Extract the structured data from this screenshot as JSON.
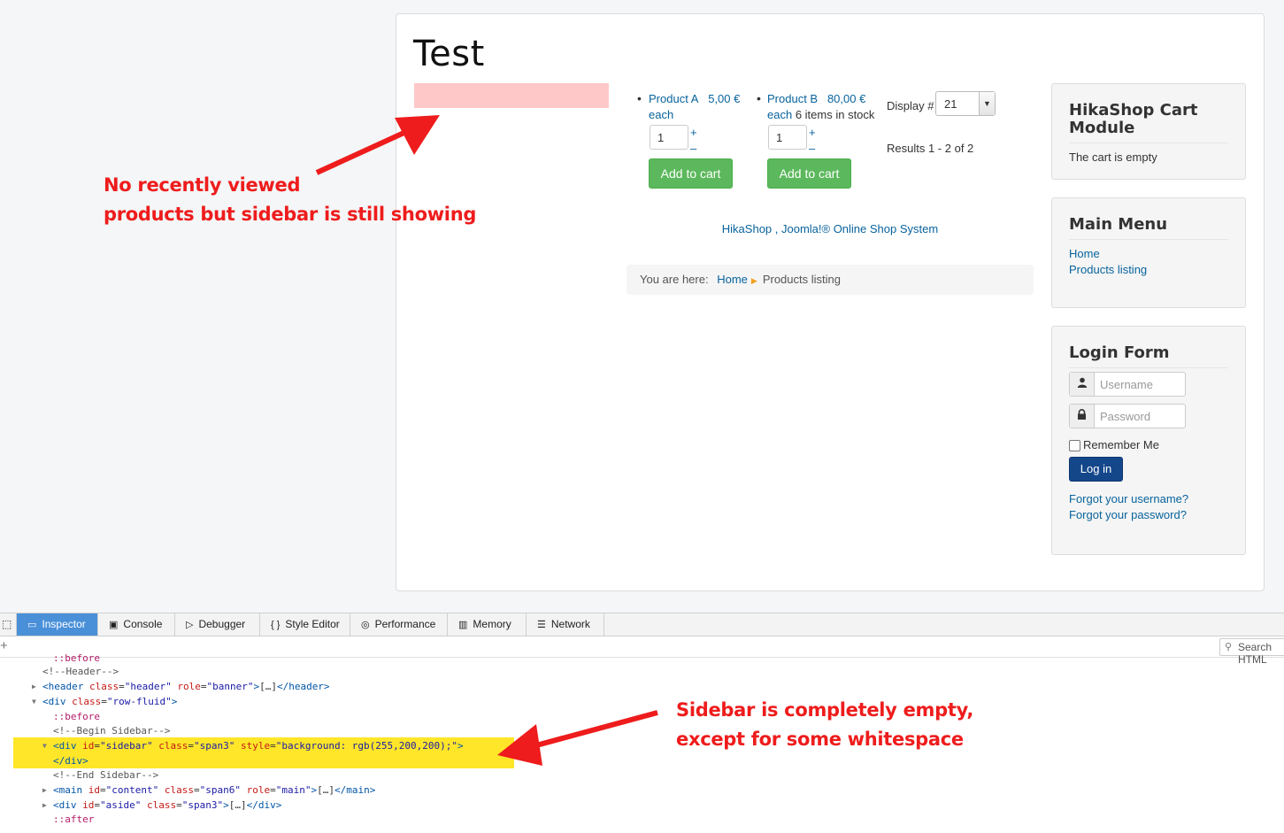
{
  "page": {
    "title": "Test"
  },
  "products": [
    {
      "name": "Product A",
      "price": "5,00 €",
      "price_suffix": "each",
      "stock": "",
      "qty": "1",
      "add_label": "Add to cart"
    },
    {
      "name": "Product B",
      "price": "80,00 €",
      "price_suffix": "each",
      "stock": "6 items in stock",
      "qty": "1",
      "add_label": "Add to cart"
    }
  ],
  "listing": {
    "display_label": "Display #",
    "display_value": "21",
    "results": "Results 1 - 2 of 2",
    "qty_plus": "+",
    "qty_minus": "–"
  },
  "powered_by": "HikaShop , Joomla!® Online Shop System",
  "breadcrumb": {
    "prefix": "You are here:",
    "items": [
      "Home",
      "Products listing"
    ]
  },
  "modules": {
    "cart": {
      "title": "HikaShop Cart Module",
      "text": "The cart is empty"
    },
    "menu": {
      "title": "Main Menu",
      "items": [
        "Home",
        "Products listing"
      ]
    },
    "login": {
      "title": "Login Form",
      "username_placeholder": "Username",
      "password_placeholder": "Password",
      "remember_label": "Remember Me",
      "login_label": "Log in",
      "forgot_username": "Forgot your username?",
      "forgot_password": "Forgot your password?"
    }
  },
  "annotations": {
    "note1": [
      "No recently viewed",
      "products but sidebar is still showing"
    ],
    "note2": [
      "Sidebar is completely empty,",
      "except for some whitespace"
    ],
    "color": "#ee1c1c"
  },
  "devtools": {
    "tabs": [
      "Inspector",
      "Console",
      "Debugger",
      "Style Editor",
      "Performance",
      "Memory",
      "Network"
    ],
    "search_placeholder": "Search HTML",
    "lines": [
      "::before",
      "<!--Header-->",
      "<header class=\"header\" role=\"banner\">…</header>",
      "<div class=\"row-fluid\">",
      "::before",
      "<!--Begin Sidebar-->",
      "<div id=\"sidebar\" class=\"span3\" style=\"background: rgb(255,200,200);\">",
      "</div>",
      "<!--End Sidebar-->",
      "<main id=\"content\" class=\"span6\" role=\"main\">…</main>",
      "<div id=\"aside\" class=\"span3\">…</div>",
      "::after"
    ]
  },
  "colors": {
    "link": "#08639c",
    "cart_button": "#5cb85c",
    "login_button": "#14478a",
    "sidebar_bg": "rgb(255,200,200)",
    "highlight": "#ffe629",
    "devtools_active_tab": "#4a90d9"
  }
}
